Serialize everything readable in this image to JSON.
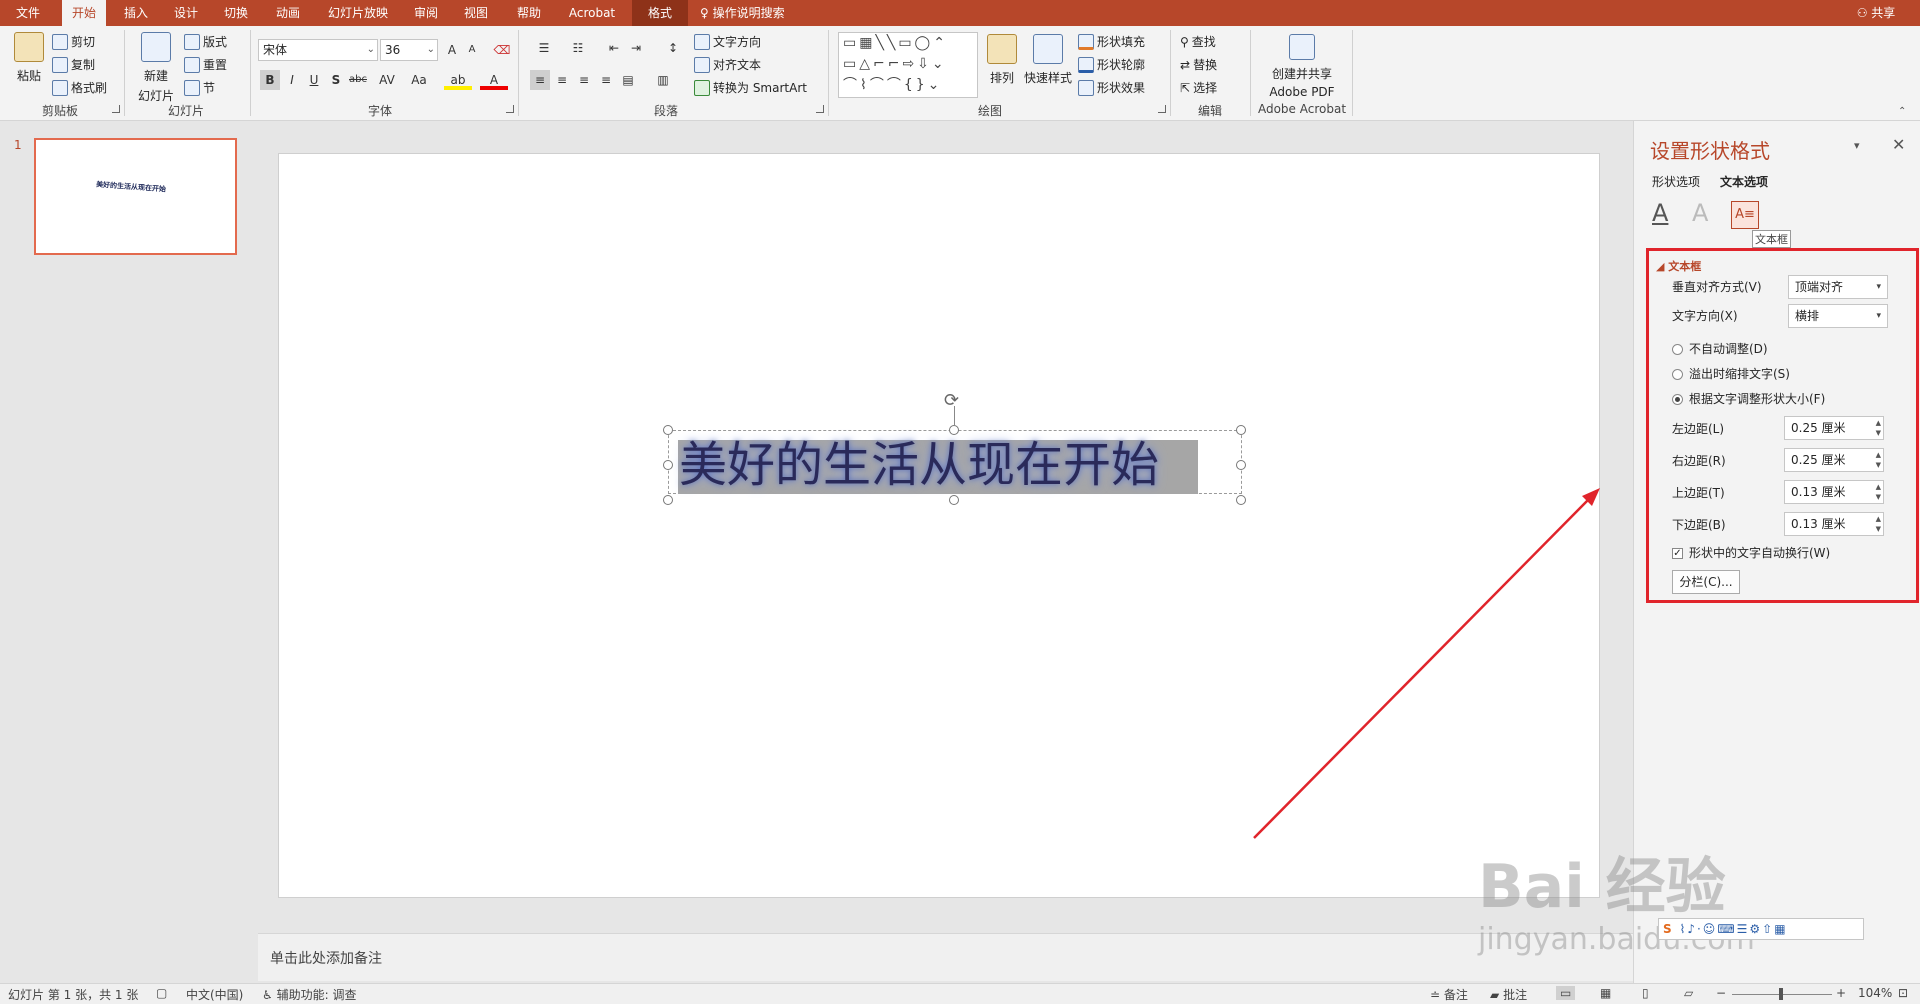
{
  "tabs": [
    "文件",
    "开始",
    "插入",
    "设计",
    "切换",
    "动画",
    "幻灯片放映",
    "审阅",
    "视图",
    "帮助",
    "Acrobat",
    "格式"
  ],
  "active_tab": "开始",
  "tell_me": "操作说明搜索",
  "share": "共享",
  "ribbon": {
    "clipboard": {
      "paste": "粘贴",
      "cut": "剪切",
      "copy": "复制",
      "format_painter": "格式刷",
      "label": "剪贴板"
    },
    "slides": {
      "new_slide_line1": "新建",
      "new_slide_line2": "幻灯片",
      "layout": "版式",
      "reset": "重置",
      "section": "节",
      "label": "幻灯片"
    },
    "font": {
      "family": "宋体",
      "size": "36",
      "bold": "B",
      "italic": "I",
      "underline": "U",
      "shadow": "S",
      "strike": "abc",
      "spacing": "AV",
      "case": "Aa",
      "grow": "A",
      "shrink": "A",
      "label": "字体"
    },
    "paragraph": {
      "text_direction": "文字方向",
      "align_text": "对齐文本",
      "smartart": "转换为 SmartArt",
      "label": "段落"
    },
    "drawing": {
      "arrange": "排列",
      "quick_styles": "快速样式",
      "fill": "形状填充",
      "outline": "形状轮廓",
      "effects": "形状效果",
      "label": "绘图"
    },
    "editing": {
      "find": "查找",
      "replace": "替换",
      "select": "选择",
      "label": "编辑"
    },
    "acrobat": {
      "create_line1": "创建并共享",
      "create_line2": "Adobe PDF",
      "label": "Adobe Acrobat"
    }
  },
  "thumbnail": {
    "number": "1",
    "text": "美好的生活从现在开始"
  },
  "slide": {
    "text": "美好的生活从现在开始"
  },
  "notes_placeholder": "单击此处添加备注",
  "pane": {
    "title": "设置形状格式",
    "tab_shape": "形状选项",
    "tab_text": "文本选项",
    "tooltip": "文本框",
    "section": "文本框",
    "valign_label": "垂直对齐方式(V)",
    "valign_value": "顶端对齐",
    "direction_label": "文字方向(X)",
    "direction_value": "横排",
    "opt_no_autofit": "不自动调整(D)",
    "opt_shrink": "溢出时缩排文字(S)",
    "opt_resize": "根据文字调整形状大小(F)",
    "left_label": "左边距(L)",
    "left_value": "0.25 厘米",
    "right_label": "右边距(R)",
    "right_value": "0.25 厘米",
    "top_label": "上边距(T)",
    "top_value": "0.13 厘米",
    "bottom_label": "下边距(B)",
    "bottom_value": "0.13 厘米",
    "wrap_label": "形状中的文字自动换行(W)",
    "columns_btn": "分栏(C)..."
  },
  "status": {
    "slide_info": "幻灯片 第 1 张，共 1 张",
    "language": "中文(中国)",
    "accessibility": "辅助功能: 调查",
    "notes": "备注",
    "comments": "批注",
    "zoom": "104%"
  },
  "watermark": {
    "logo": "Bai  经验",
    "url": "jingyan.baidu.com"
  },
  "colors": {
    "accent": "#b7472a",
    "highlight_box": "#e0242b",
    "arrow": "#e0242b"
  }
}
